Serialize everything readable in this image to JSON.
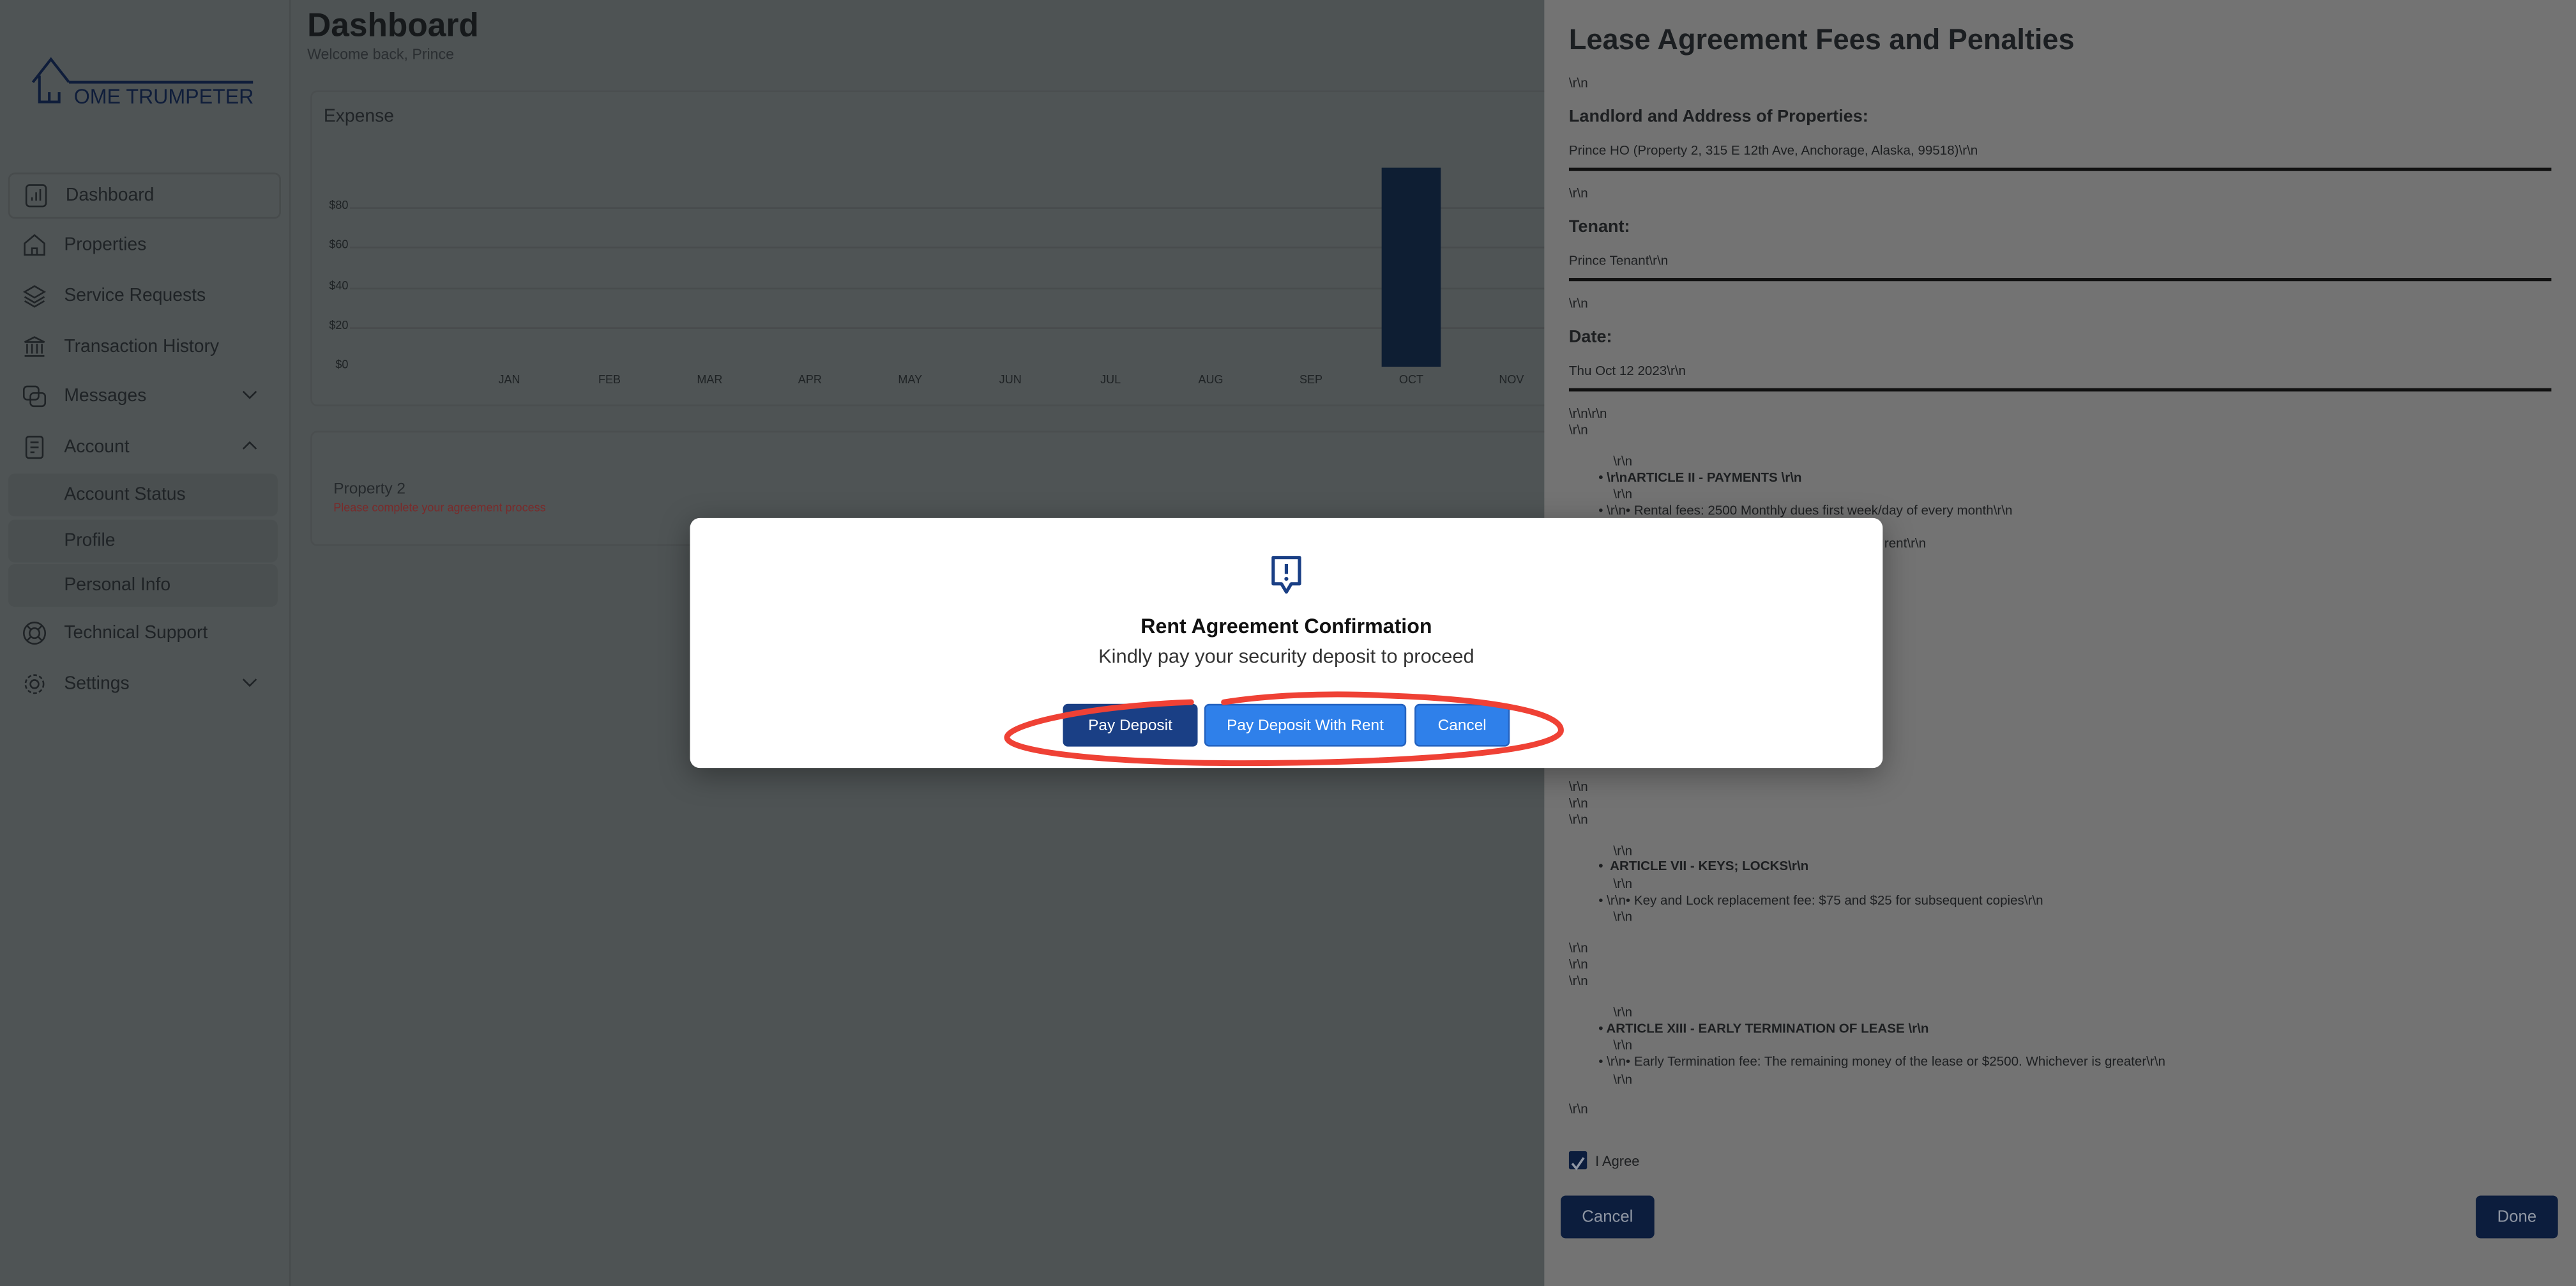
{
  "brand": {
    "logo_text": "OME TRUMPETER"
  },
  "sidebar": {
    "items": [
      {
        "label": "Dashboard",
        "icon": "bar-chart-icon"
      },
      {
        "label": "Properties",
        "icon": "home-icon"
      },
      {
        "label": "Service Requests",
        "icon": "layers-icon"
      },
      {
        "label": "Transaction History",
        "icon": "bank-icon"
      },
      {
        "label": "Messages",
        "icon": "chat-icon"
      },
      {
        "label": "Account",
        "icon": "document-icon"
      },
      {
        "label": "Account Status"
      },
      {
        "label": "Profile"
      },
      {
        "label": "Personal Info"
      },
      {
        "label": "Technical Support",
        "icon": "lifebuoy-icon"
      },
      {
        "label": "Settings",
        "icon": "gear-icon"
      }
    ]
  },
  "header": {
    "title": "Dashboard",
    "subtitle": "Welcome back, Prince"
  },
  "expense_card": {
    "title": "Expense"
  },
  "chart_data": {
    "type": "bar",
    "title": "Expense",
    "categories": [
      "JAN",
      "FEB",
      "MAR",
      "APR",
      "MAY",
      "JUN",
      "JUL",
      "AUG",
      "SEP",
      "OCT",
      "NOV"
    ],
    "values": [
      0,
      0,
      0,
      0,
      0,
      0,
      0,
      0,
      0,
      100,
      0
    ],
    "yticks": [
      "$0",
      "$20",
      "$40",
      "$60",
      "$80"
    ],
    "ylim": [
      0,
      100
    ],
    "grid": true,
    "bar_color": "#0e1e33"
  },
  "property_card": {
    "name": "Property 2",
    "warning": "Please complete your agreement process",
    "warning_color": "#b42318"
  },
  "drawer": {
    "title": "Lease Agreement Fees and Penalties",
    "crlf": "\\r\\n",
    "crlf2": "\\r\\n\\r\\n",
    "landlord_label": "Landlord and Address of Properties:",
    "landlord_value": "Prince HO (Property 2, 315 E 12th Ave, Anchorage, Alaska, 99518)\\r\\n",
    "tenant_label": "Tenant:",
    "tenant_value": "Prince Tenant\\r\\n",
    "date_label": "Date:",
    "date_value": "Thu Oct 12 2023\\r\\n",
    "article2": "\\r\\nARTICLE II - PAYMENTS \\r\\n",
    "rental_fees": "\\r\\n• Rental fees: 2500 Monthly dues first week/day of every month\\r\\n",
    "partial_line": "rent\\r\\n",
    "article7": " ARTICLE VII - KEYS; LOCKS\\r\\n",
    "key_fee": "\\r\\n• Key and Lock replacement fee: $75 and $25 for subsequent copies\\r\\n",
    "article13": "ARTICLE XIII - EARLY TERMINATION OF LEASE \\r\\n",
    "termination_fee": "\\r\\n• Early Termination fee: The remaining money of the lease or $2500. Whichever is greater\\r\\n",
    "agree_label": "I Agree",
    "agree_checked": true,
    "cancel_label": "Cancel",
    "done_label": "Done"
  },
  "modal": {
    "icon": "alert-message-icon",
    "title": "Rent Agreement Confirmation",
    "message": "Kindly pay your security deposit to proceed",
    "pay_deposit": "Pay Deposit",
    "pay_with_rent": "Pay Deposit With Rent",
    "cancel": "Cancel",
    "colors": {
      "primary": "#1a3f85",
      "secondary": "#2f80ea",
      "annotation": "#ef4135"
    }
  }
}
